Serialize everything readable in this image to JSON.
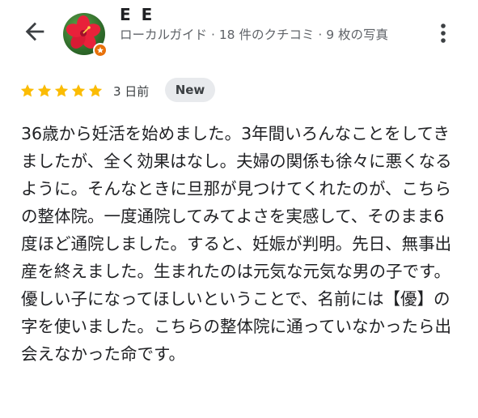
{
  "header": {
    "back_icon": "arrow-back-icon",
    "avatar_icon": "hibiscus-flower-avatar",
    "badge_icon": "local-guide-badge-icon",
    "user_name": "E E",
    "user_meta": "ローカルガイド · 18 件のクチコミ · 9 枚の写真",
    "more_icon": "more-vert-icon"
  },
  "review": {
    "rating": 5,
    "rating_max": 5,
    "star_color": "#fbbc04",
    "date": "3 日前",
    "badge": "New",
    "text": "36歳から妊活を始めました。3年間いろんなことをしてきましたが、全く効果はなし。夫婦の関係も徐々に悪くなるように。そんなときに旦那が見つけてくれたのが、こちらの整体院。一度通院してみてよさを実感して、そのまま6度ほど通院しました。すると、妊娠が判明。先日、無事出産を終えました。生まれたのは元気な元気な男の子です。優しい子になってほしいということで、名前には【優】の字を使いました。こちらの整体院に通っていなかったら出会えなかった命です。"
  }
}
